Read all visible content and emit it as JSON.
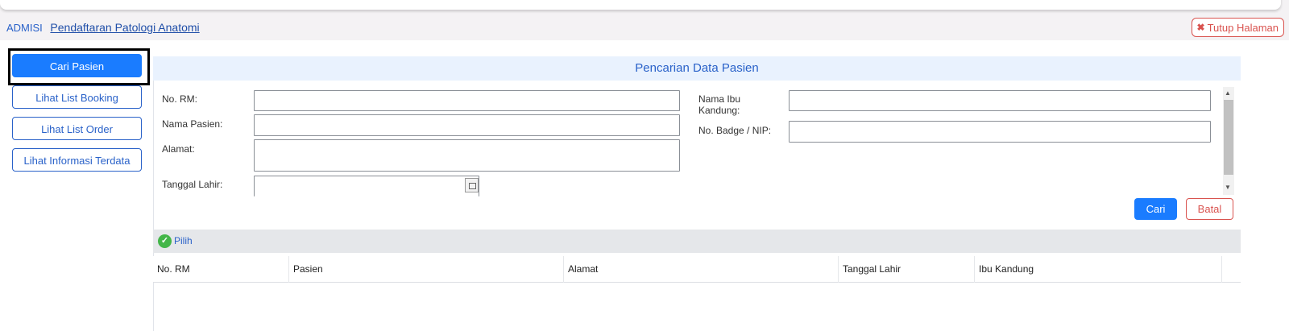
{
  "breadcrumb": {
    "root": "ADMISI",
    "page": "Pendaftaran Patologi Anatomi"
  },
  "close_button": {
    "icon": "close-icon",
    "label": "Tutup Halaman"
  },
  "sidebar": {
    "items": [
      {
        "label": "Cari Pasien",
        "active": true
      },
      {
        "label": "Lihat List Booking"
      },
      {
        "label": "Lihat List Order"
      },
      {
        "label": "Lihat Informasi Terdata"
      }
    ]
  },
  "search": {
    "title": "Pencarian Data Pasien",
    "labels": {
      "no_rm": "No. RM:",
      "nama_pasien": "Nama Pasien:",
      "alamat": "Alamat:",
      "tanggal_lahir": "Tanggal Lahir:",
      "nama_ibu_line1": "Nama Ibu",
      "nama_ibu_line2": "Kandung:",
      "badge": "No. Badge / NIP:"
    },
    "values": {
      "no_rm": "",
      "nama_pasien": "",
      "alamat": "",
      "tanggal_lahir": "",
      "nama_ibu": "",
      "badge": ""
    },
    "search_button": "Cari",
    "cancel_button": "Batal"
  },
  "results": {
    "select_label": "Pilih",
    "columns": [
      "No. RM",
      "Pasien",
      "Alamat",
      "Tanggal Lahir",
      "Ibu Kandung"
    ],
    "rows": []
  },
  "colors": {
    "primary": "#1a7cff",
    "danger": "#d9534f",
    "header_bg": "#e9f2fe",
    "success": "#43b649"
  }
}
